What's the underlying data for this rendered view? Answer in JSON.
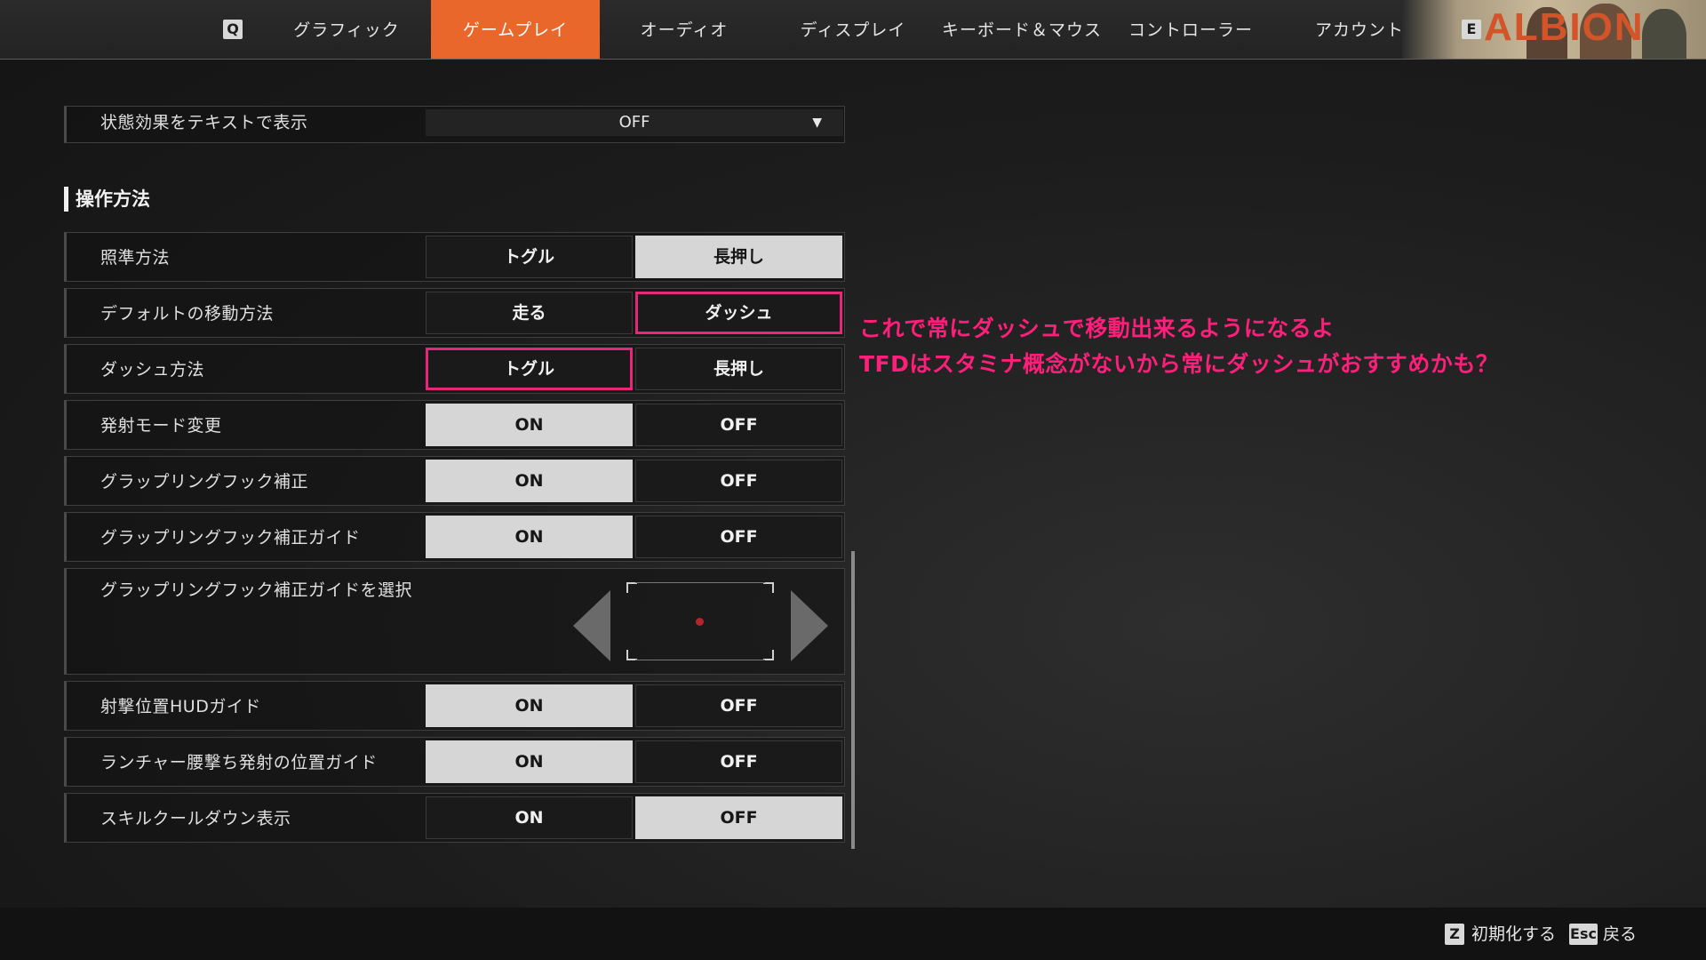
{
  "nav": {
    "left_key": "Q",
    "right_key": "E",
    "tabs": [
      {
        "label": "グラフィック"
      },
      {
        "label": "ゲームプレイ"
      },
      {
        "label": "オーディオ"
      },
      {
        "label": "ディスプレイ"
      },
      {
        "label": "キーボード＆マウス"
      },
      {
        "label": "コントローラー"
      },
      {
        "label": "アカウント"
      }
    ],
    "active_tab": "ゲームプレイ",
    "banner_text": "ALBION"
  },
  "top_row": {
    "label": "状態効果をテキストで表示",
    "value": "OFF",
    "arrow": "▼"
  },
  "section": {
    "title": "操作方法"
  },
  "rows": [
    {
      "label": "照準方法",
      "options": [
        "トグル",
        "長押し"
      ],
      "selected": 1
    },
    {
      "label": "デフォルトの移動方法",
      "options": [
        "走る",
        "ダッシュ"
      ],
      "selected": -1,
      "highlighted": 1
    },
    {
      "label": "ダッシュ方法",
      "options": [
        "トグル",
        "長押し"
      ],
      "selected": -1,
      "highlighted": 0
    },
    {
      "label": "発射モード変更",
      "options": [
        "ON",
        "OFF"
      ],
      "selected": 0
    },
    {
      "label": "グラップリングフック補正",
      "options": [
        "ON",
        "OFF"
      ],
      "selected": 0
    },
    {
      "label": "グラップリングフック補正ガイド",
      "options": [
        "ON",
        "OFF"
      ],
      "selected": 0
    }
  ],
  "guide_row": {
    "label": "グラップリングフック補正ガイドを選択"
  },
  "rows2": [
    {
      "label": "射撃位置HUDガイド",
      "options": [
        "ON",
        "OFF"
      ],
      "selected": 0
    },
    {
      "label": "ランチャー腰撃ち発射の位置ガイド",
      "options": [
        "ON",
        "OFF"
      ],
      "selected": 0
    },
    {
      "label": "スキルクールダウン表示",
      "options": [
        "ON",
        "OFF"
      ],
      "selected": 1
    }
  ],
  "annotation": {
    "line1": "これで常にダッシュで移動出来るようになるよ",
    "line2": "TFDはスタミナ概念がないから常にダッシュがおすすめかも？",
    "color": "#ff1f7a"
  },
  "footer": {
    "reset_key": "Z",
    "reset_label": "初期化する",
    "back_key": "Esc",
    "back_label": "戻る"
  },
  "colors": {
    "accent": "#e9672a",
    "highlight": "#e6287a",
    "selected_bg": "#d6d6d6"
  }
}
